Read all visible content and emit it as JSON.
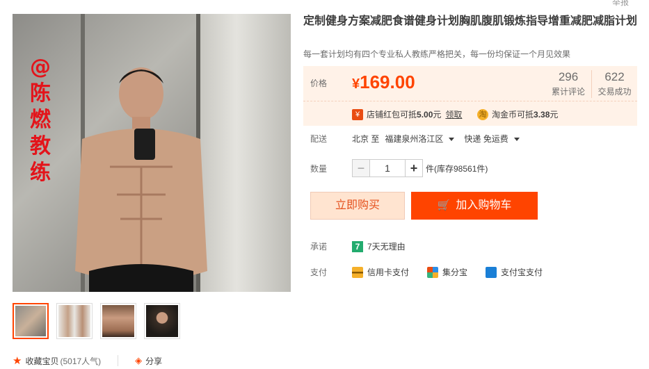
{
  "report_link": "举报",
  "product": {
    "title": "定制健身方案减肥食谱健身计划胸肌腹肌锻炼指导增重减肥减脂计划",
    "subtitle": "每一套计划均有四个专业私人教练严格把关，每一份均保证一个月见效果",
    "watermark": [
      "@",
      "陈",
      "燃",
      "教",
      "练"
    ]
  },
  "price": {
    "label": "价格",
    "currency": "¥",
    "value": "169.00",
    "stats": [
      {
        "count": "296",
        "label": "累计评论"
      },
      {
        "count": "622",
        "label": "交易成功"
      }
    ]
  },
  "promos": {
    "shop_coupon_prefix": "店铺红包可抵",
    "shop_coupon_amount": "5.00",
    "shop_coupon_unit": "元",
    "shop_coupon_link": "领取",
    "coin_prefix": "淘金币可抵",
    "coin_amount": "3.38",
    "coin_unit": "元",
    "coupon_icon": "¥",
    "coin_icon": "淘"
  },
  "delivery": {
    "label": "配送",
    "from": "北京 至",
    "to": "福建泉州洛江区",
    "method": "快递 免运费"
  },
  "quantity": {
    "label": "数量",
    "minus": "−",
    "plus": "+",
    "value": "1",
    "stock": "件(库存98561件)"
  },
  "buttons": {
    "buy_now": "立即购买",
    "add_to_cart": "加入购物车"
  },
  "promise": {
    "label": "承诺",
    "badge": "7",
    "text": "7天无理由"
  },
  "payment": {
    "label": "支付",
    "methods": [
      "信用卡支付",
      "集分宝",
      "支付宝支付"
    ]
  },
  "footer": {
    "favorite": "收藏宝贝",
    "favorite_count": "(5017人气)",
    "share": "分享"
  },
  "colors": {
    "accent": "#ff4400",
    "price_bg": "#fff2e8",
    "watermark": "#e3141b"
  }
}
